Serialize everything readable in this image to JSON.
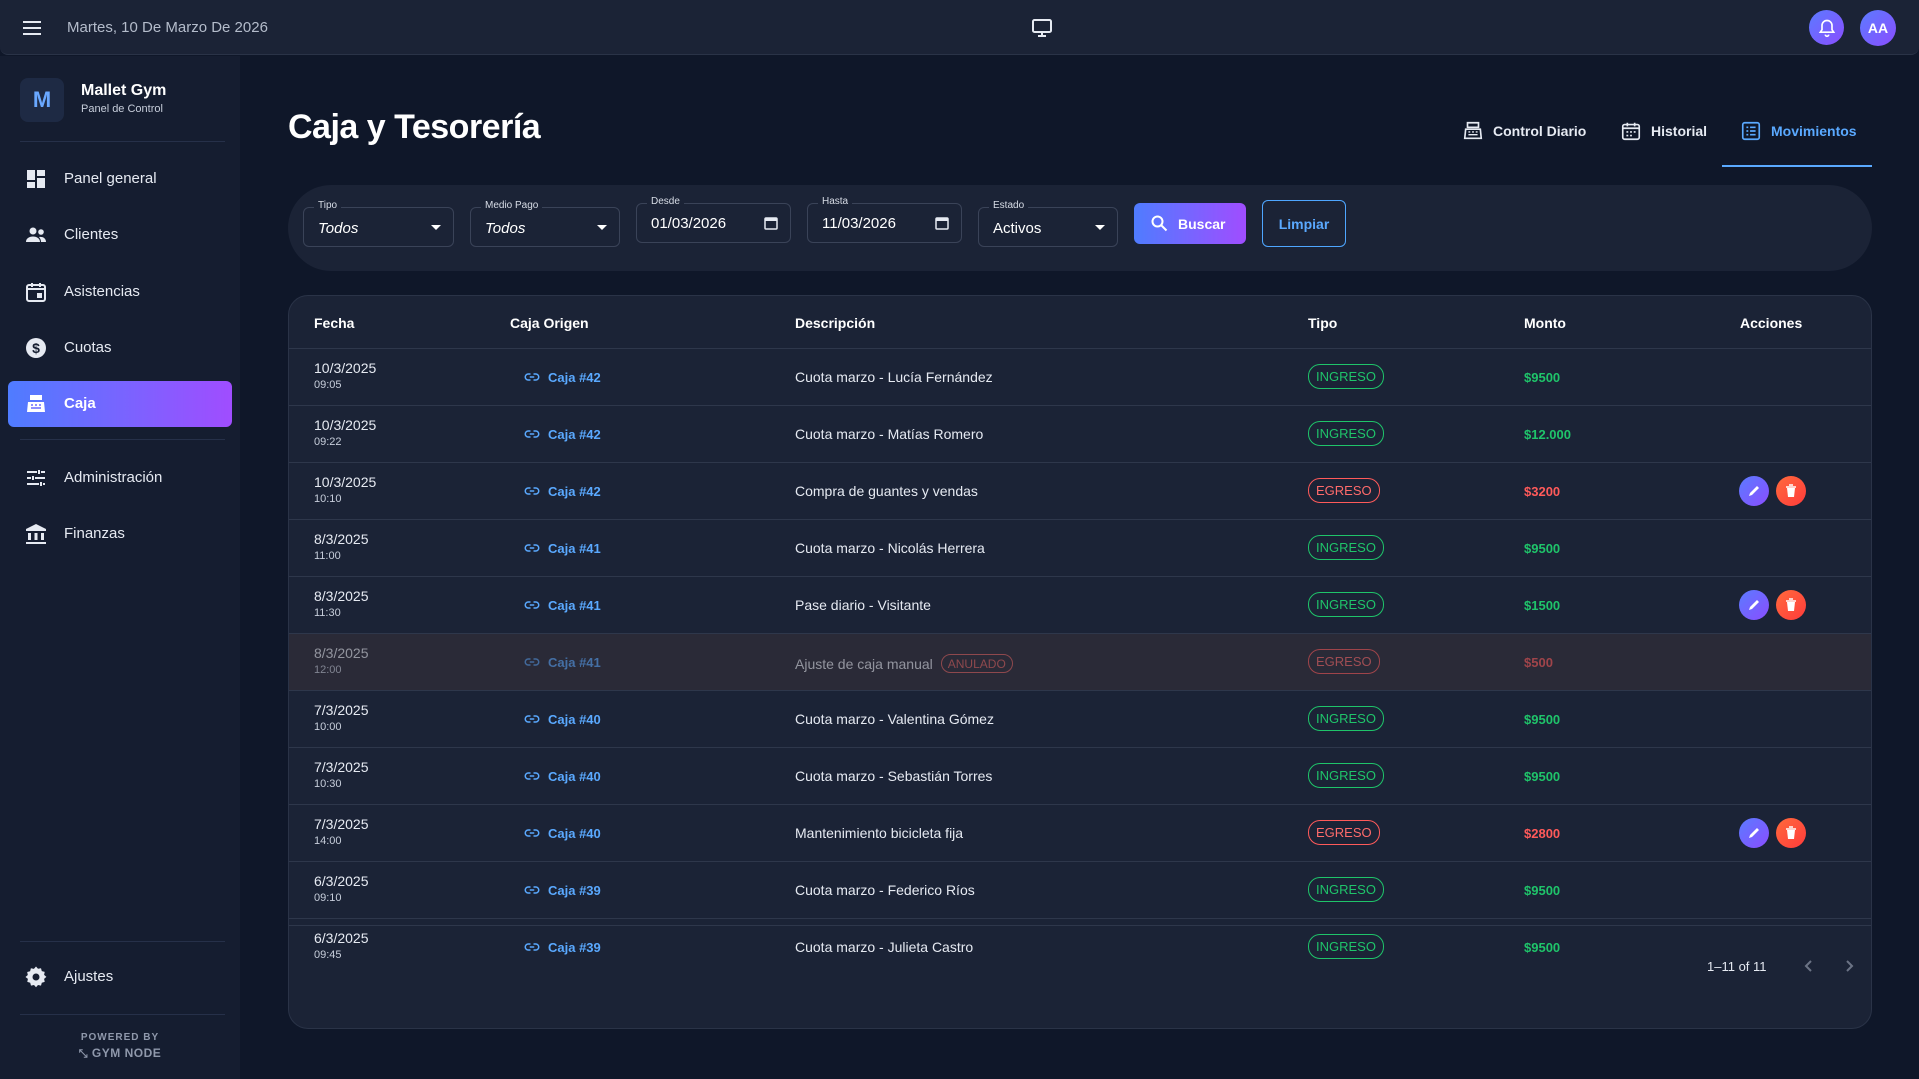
{
  "topbar": {
    "date": "Martes, 10 De Marzo De 2026",
    "avatar_initials": "AA",
    "icons": [
      "menu-icon",
      "monitor-icon",
      "bell-icon"
    ]
  },
  "brand": {
    "logo_letter": "M",
    "name": "Mallet Gym",
    "subtitle": "Panel de Control"
  },
  "sidebar": {
    "items": [
      {
        "label": "Panel general",
        "icon": "dashboard-icon"
      },
      {
        "label": "Clientes",
        "icon": "people-icon"
      },
      {
        "label": "Asistencias",
        "icon": "calendar-icon"
      },
      {
        "label": "Cuotas",
        "icon": "dollar-icon"
      },
      {
        "label": "Caja",
        "icon": "cash-register-icon",
        "active": true
      },
      {
        "label": "Administración",
        "icon": "sliders-icon"
      },
      {
        "label": "Finanzas",
        "icon": "bank-icon"
      }
    ],
    "settings_label": "Ajustes",
    "powered_line1": "POWERED BY",
    "powered_line2": "GYM NODE"
  },
  "page": {
    "title": "Caja y Tesorería",
    "tabs": [
      {
        "label": "Control Diario",
        "icon": "cash-register-icon"
      },
      {
        "label": "Historial",
        "icon": "calendar-icon"
      },
      {
        "label": "Movimientos",
        "icon": "list-icon",
        "active": true
      }
    ]
  },
  "filters": {
    "tipo": {
      "label": "Tipo",
      "value": "Todos"
    },
    "medio_pago": {
      "label": "Medio Pago",
      "value": "Todos"
    },
    "desde": {
      "label": "Desde",
      "value": "01/03/2026"
    },
    "hasta": {
      "label": "Hasta",
      "value": "11/03/2026"
    },
    "estado": {
      "label": "Estado",
      "value": "Activos"
    },
    "buscar_label": "Buscar",
    "limpiar_label": "Limpiar"
  },
  "table": {
    "headers": [
      "Fecha",
      "Caja Origen",
      "Descripción",
      "Tipo",
      "Monto",
      "Acciones"
    ],
    "rows": [
      {
        "date": "10/3/2025",
        "time": "09:05",
        "caja": "Caja #42",
        "desc": "Cuota marzo - Lucía Fernández",
        "tipo": "INGRESO",
        "monto": "$9500"
      },
      {
        "date": "10/3/2025",
        "time": "09:22",
        "caja": "Caja #42",
        "desc": "Cuota marzo - Matías Romero",
        "tipo": "INGRESO",
        "monto": "$12.000"
      },
      {
        "date": "10/3/2025",
        "time": "10:10",
        "caja": "Caja #42",
        "desc": "Compra de guantes y vendas",
        "tipo": "EGRESO",
        "monto": "$3200",
        "actions": true
      },
      {
        "date": "8/3/2025",
        "time": "11:00",
        "caja": "Caja #41",
        "desc": "Cuota marzo - Nicolás Herrera",
        "tipo": "INGRESO",
        "monto": "$9500"
      },
      {
        "date": "8/3/2025",
        "time": "11:30",
        "caja": "Caja #41",
        "desc": "Pase diario - Visitante",
        "tipo": "INGRESO",
        "monto": "$1500",
        "actions": true
      },
      {
        "date": "8/3/2025",
        "time": "12:00",
        "caja": "Caja #41",
        "desc": "Ajuste de caja manual",
        "badge": "ANULADO",
        "tipo": "EGRESO",
        "monto": "$500",
        "voided": true
      },
      {
        "date": "7/3/2025",
        "time": "10:00",
        "caja": "Caja #40",
        "desc": "Cuota marzo - Valentina Gómez",
        "tipo": "INGRESO",
        "monto": "$9500"
      },
      {
        "date": "7/3/2025",
        "time": "10:30",
        "caja": "Caja #40",
        "desc": "Cuota marzo - Sebastián Torres",
        "tipo": "INGRESO",
        "monto": "$9500"
      },
      {
        "date": "7/3/2025",
        "time": "14:00",
        "caja": "Caja #40",
        "desc": "Mantenimiento bicicleta fija",
        "tipo": "EGRESO",
        "monto": "$2800",
        "actions": true
      },
      {
        "date": "6/3/2025",
        "time": "09:10",
        "caja": "Caja #39",
        "desc": "Cuota marzo - Federico Ríos",
        "tipo": "INGRESO",
        "monto": "$9500"
      },
      {
        "date": "6/3/2025",
        "time": "09:45",
        "caja": "Caja #39",
        "desc": "Cuota marzo - Julieta Castro",
        "tipo": "INGRESO",
        "monto": "$9500"
      }
    ],
    "pagination": "1–11 of 11"
  },
  "colors": {
    "accent_start": "#4f7cff",
    "accent_end": "#a04dff",
    "ingreso": "#1fc46a",
    "egreso": "#ff5a5a",
    "link": "#5aa9ff"
  }
}
